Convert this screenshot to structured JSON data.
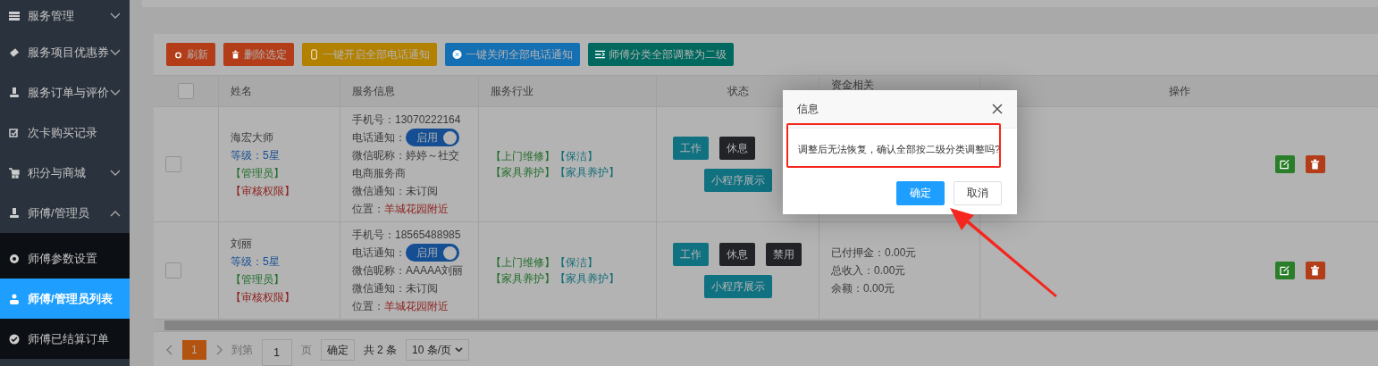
{
  "sidebar": {
    "items": [
      {
        "label": "服务管理",
        "kind": "list",
        "expanded": false
      },
      {
        "label": "服务项目优惠券",
        "kind": "ticket",
        "expanded": false
      },
      {
        "label": "服务订单与评价",
        "kind": "person",
        "expanded": false
      },
      {
        "label": "次卡购买记录",
        "kind": "check"
      },
      {
        "label": "积分与商城",
        "kind": "cart",
        "expanded": false
      },
      {
        "label": "师傅/管理员",
        "kind": "person",
        "expanded": true,
        "children": [
          {
            "label": "师傅参数设置",
            "kind": "gear",
            "selected": false
          },
          {
            "label": "师傅/管理员列表",
            "kind": "group",
            "selected": true
          },
          {
            "label": "师傅已结算订单",
            "kind": "done",
            "selected": false
          }
        ]
      }
    ]
  },
  "toolbar": [
    {
      "label": "刷新",
      "kind": "refresh",
      "color": "#b33d18"
    },
    {
      "label": "删除选定",
      "kind": "trash",
      "color": "#b33d18"
    },
    {
      "label": "一键开启全部电话通知",
      "kind": "phone",
      "color": "#b38100"
    },
    {
      "label": "一键关闭全部电话通知",
      "kind": "close",
      "color": "#156fb3"
    },
    {
      "label": "师傅分类全部调整为二级",
      "kind": "levels",
      "color": "#00695f"
    }
  ],
  "table": {
    "select_all_checked": false,
    "columns": [
      "姓名",
      "服务信息",
      "服务行业",
      "状态",
      "资金相关",
      "操作"
    ],
    "rows": [
      {
        "checked": false,
        "name": "海宏大师",
        "level": "等级：5星",
        "role": "【管理员】",
        "permission": "【审核权限】",
        "info": {
          "phone_label": "手机号：",
          "phone": "13070222164",
          "notify_label": "电话通知：",
          "notify": {
            "on": true,
            "label": "启用"
          },
          "wechat_name": "微信昵称：婷婷～社交电商服务商",
          "wechat_notify": "微信通知：未订阅",
          "location_label": "位置：",
          "location": "羊城花园附近"
        },
        "industries": [
          {
            "label": "【上门维修】",
            "color": "#206e2a"
          },
          {
            "label": "【保洁】",
            "color": "#126c76"
          },
          {
            "label": "【家具养护】",
            "color": "#206e2a"
          },
          {
            "label": "【家具养护】",
            "color": "#126c76"
          }
        ],
        "status_buttons": [
          {
            "label": "工作",
            "kind": "work"
          },
          {
            "label": "休息",
            "kind": "rest"
          }
        ],
        "mini_button": "小程序展示",
        "funds": []
      },
      {
        "checked": false,
        "name": "刘丽",
        "level": "等级：5星",
        "role": "【管理员】",
        "permission": "【审核权限】",
        "info": {
          "phone_label": "手机号：",
          "phone": "18565488985",
          "notify_label": "电话通知：",
          "notify": {
            "on": true,
            "label": "启用"
          },
          "wechat_name": "微信昵称：AAAAA刘丽",
          "wechat_notify": "微信通知：未订阅",
          "location_label": "位置：",
          "location": "羊城花园附近"
        },
        "industries": [
          {
            "label": "【上门维修】",
            "color": "#206e2a"
          },
          {
            "label": "【保洁】",
            "color": "#126c76"
          },
          {
            "label": "【家具养护】",
            "color": "#206e2a"
          },
          {
            "label": "【家具养护】",
            "color": "#126c76"
          }
        ],
        "status_buttons": [
          {
            "label": "工作",
            "kind": "work"
          },
          {
            "label": "休息",
            "kind": "rest"
          },
          {
            "label": "禁用",
            "kind": "ban"
          }
        ],
        "mini_button": "小程序展示",
        "funds": [
          "已付押金：0.00元",
          "总收入：0.00元",
          "余额：0.00元"
        ]
      }
    ]
  },
  "pagination": {
    "pages": [
      {
        "label": "1",
        "selected": true
      }
    ],
    "goto_label": "到第",
    "goto_value": "1",
    "page_label": "页",
    "confirm": "确定",
    "total": "共 2 条",
    "page_size": "10 条/页"
  },
  "dialog": {
    "title": "信息",
    "message": "调整后无法恢复，确认全部按二级分类调整吗?",
    "buttons": [
      {
        "label": "确定",
        "kind": "primary"
      },
      {
        "label": "取消",
        "kind": "plain"
      }
    ]
  }
}
